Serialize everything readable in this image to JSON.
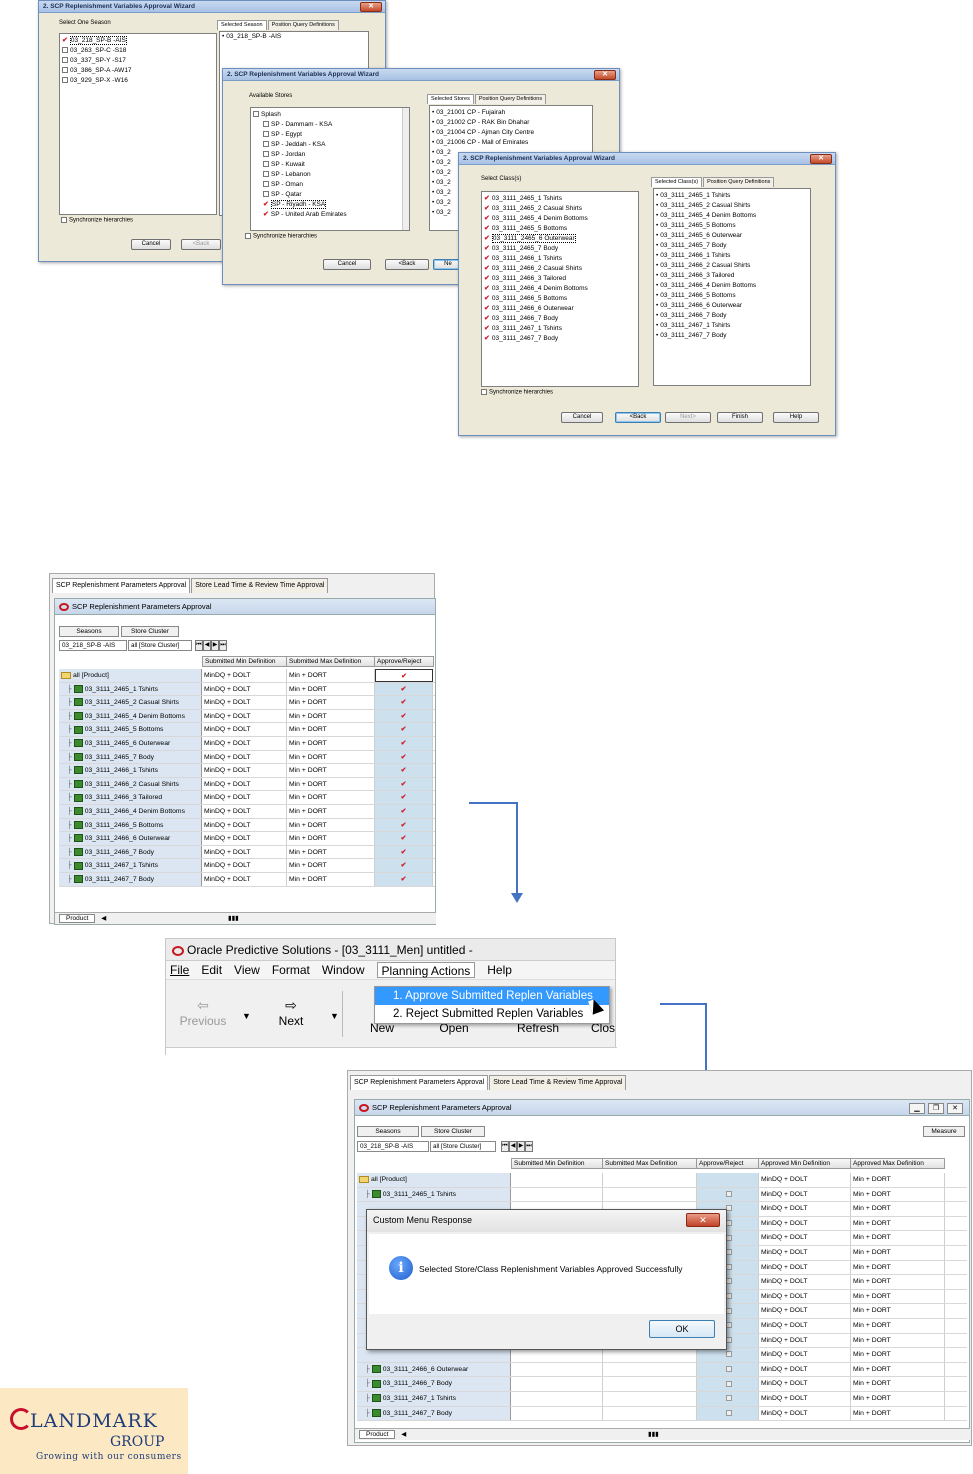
{
  "wizard1": {
    "title": "2. SCP Replenishment Variables Approval Wizard",
    "group_label": "Select One Season",
    "seasons": [
      {
        "label": "03_218_SP-B -AIS",
        "checked": true
      },
      {
        "label": "03_263_SP-C -S18",
        "checked": false
      },
      {
        "label": "03_337_SP-Y -S17",
        "checked": false
      },
      {
        "label": "03_386_SP-A -AW17",
        "checked": false
      },
      {
        "label": "03_929_SP-X -W16",
        "checked": false
      }
    ],
    "tab_selected": "Selected Season",
    "tab_position": "Position Query Definitions",
    "selected": [
      "03_218_SP-B -AIS"
    ],
    "sync_label": "Synchronize hierarchies",
    "cancel": "Cancel",
    "back": "<Back"
  },
  "wizard2": {
    "title": "2. SCP Replenishment Variables Approval Wizard",
    "group_label": "Available Stores",
    "stores": [
      {
        "label": "Splash",
        "checked": false,
        "level": 0
      },
      {
        "label": "SP - Dammam - KSA",
        "checked": false,
        "level": 1
      },
      {
        "label": "SP - Egypt",
        "checked": false,
        "level": 1
      },
      {
        "label": "SP - Jeddah - KSA",
        "checked": false,
        "level": 1
      },
      {
        "label": "SP - Jordan",
        "checked": false,
        "level": 1
      },
      {
        "label": "SP - Kuwait",
        "checked": false,
        "level": 1
      },
      {
        "label": "SP - Lebanon",
        "checked": false,
        "level": 1
      },
      {
        "label": "SP - Oman",
        "checked": false,
        "level": 1
      },
      {
        "label": "SP - Qatar",
        "checked": false,
        "level": 1
      },
      {
        "label": "SP - Riyadh - KSA",
        "checked": true,
        "level": 1
      },
      {
        "label": "SP - United Arab Emirates",
        "checked": true,
        "level": 1
      }
    ],
    "tab_selected": "Selected Stores",
    "tab_position": "Position Query Definitions",
    "selected": [
      "03_21001 CP - Fujairah",
      "03_21002 CP - RAK Bin Dhahar",
      "03_21004 CP - Ajman City Centre",
      "03_21006 CP - Mall of Emirates",
      "03_2",
      "03_2",
      "03_2",
      "03_2",
      "03_2",
      "03_2",
      "03_2"
    ],
    "sync_label": "Synchronize hierarchies",
    "cancel": "Cancel",
    "back": "<Back",
    "next": "Ne"
  },
  "wizard3": {
    "title": "2. SCP Replenishment Variables Approval Wizard",
    "group_label": "Select Class(s)",
    "classes": [
      "03_3111_2465_1 Tshirts",
      "03_3111_2465_2 Casual Shirts",
      "03_3111_2465_4 Denim Bottoms",
      "03_3111_2465_5 Bottoms",
      "03_3111_2465_6 Outerwear",
      "03_3111_2465_7 Body",
      "03_3111_2466_1 Tshirts",
      "03_3111_2466_2 Casual Shirts",
      "03_3111_2466_3 Tailored",
      "03_3111_2466_4 Denim Bottoms",
      "03_3111_2466_5 Bottoms",
      "03_3111_2466_6 Outerwear",
      "03_3111_2466_7 Body",
      "03_3111_2467_1 Tshirts",
      "03_3111_2467_7 Body"
    ],
    "tab_selected": "Selected Class(s)",
    "tab_position": "Position Query Definitions",
    "sync_label": "Synchronize hierarchies",
    "cancel": "Cancel",
    "back": "<Back",
    "next": "Next>",
    "finish": "Finish",
    "help": "Help"
  },
  "grid1": {
    "tab1": "SCP Replenishment Parameters Approval",
    "tab2": "Store Lead Time & Review Time Approval",
    "title": "SCP Replenishment Parameters Approval",
    "seasons_btn": "Seasons",
    "store_cluster_btn": "Store Cluster",
    "season_value": "03_218_SP-B -AIS",
    "cluster_value": "all [Store Cluster]",
    "col_min": "Submitted Min Definition",
    "col_max": "Submitted Max Definition",
    "col_approve": "Approve/Reject",
    "root": "all [Product]",
    "min_value": "MinDQ + DOLT",
    "max_value": "Min + DORT",
    "product_tab": "Product",
    "rows": [
      "03_3111_2465_1 Tshirts",
      "03_3111_2465_2 Casual Shirts",
      "03_3111_2465_4 Denim Bottoms",
      "03_3111_2465_5 Bottoms",
      "03_3111_2465_6 Outerwear",
      "03_3111_2465_7 Body",
      "03_3111_2466_1 Tshirts",
      "03_3111_2466_2 Casual Shirts",
      "03_3111_2466_3 Tailored",
      "03_3111_2466_4 Denim Bottoms",
      "03_3111_2466_5 Bottoms",
      "03_3111_2466_6 Outerwear",
      "03_3111_2466_7 Body",
      "03_3111_2467_1 Tshirts",
      "03_3111_2467_7 Body"
    ]
  },
  "app": {
    "title": "Oracle Predictive Solutions - [03_3111_Men]  untitled -",
    "menus": [
      "File",
      "Edit",
      "View",
      "Format",
      "Window",
      "Planning Actions",
      "Help"
    ],
    "previous": "Previous",
    "next": "Next",
    "new": "New",
    "open": "Open",
    "refresh": "Refresh",
    "close": "Clos",
    "dropdown": [
      "1. Approve Submitted Replen Variables",
      "2. Reject Submitted Replen Variables"
    ]
  },
  "grid2": {
    "tab1": "SCP Replenishment Parameters Approval",
    "tab2": "Store Lead Time & Review Time Approval",
    "title": "SCP Replenishment Parameters Approval",
    "seasons_btn": "Seasons",
    "store_cluster_btn": "Store Cluster",
    "measure_btn": "Measure",
    "season_value": "03_218_SP-B -AIS",
    "cluster_value": "all [Store Cluster]",
    "col_min": "Submitted Min Definition",
    "col_max": "Submitted Max Definition",
    "col_approve": "Approve/Reject",
    "col_amin": "Approved Min Definition",
    "col_amax": "Approved Max Definition",
    "root": "all [Product]",
    "amin_value": "MinDQ + DOLT",
    "amax_value": "Min + DORT",
    "visible_rows": [
      "03_3111_2465_1 Tshirts",
      "03_3111_2466_6 Outerwear",
      "03_3111_2466_7 Body",
      "03_3111_2467_1 Tshirts",
      "03_3111_2467_7 Body"
    ],
    "product_tab": "Product"
  },
  "dialog": {
    "title": "Custom Menu Response",
    "message": "Selected Store/Class Replenishment Variables Approved Successfully",
    "ok": "OK"
  },
  "logo": {
    "name": "LANDMARK",
    "group": "GROUP",
    "tagline": "Growing with our consumers"
  }
}
